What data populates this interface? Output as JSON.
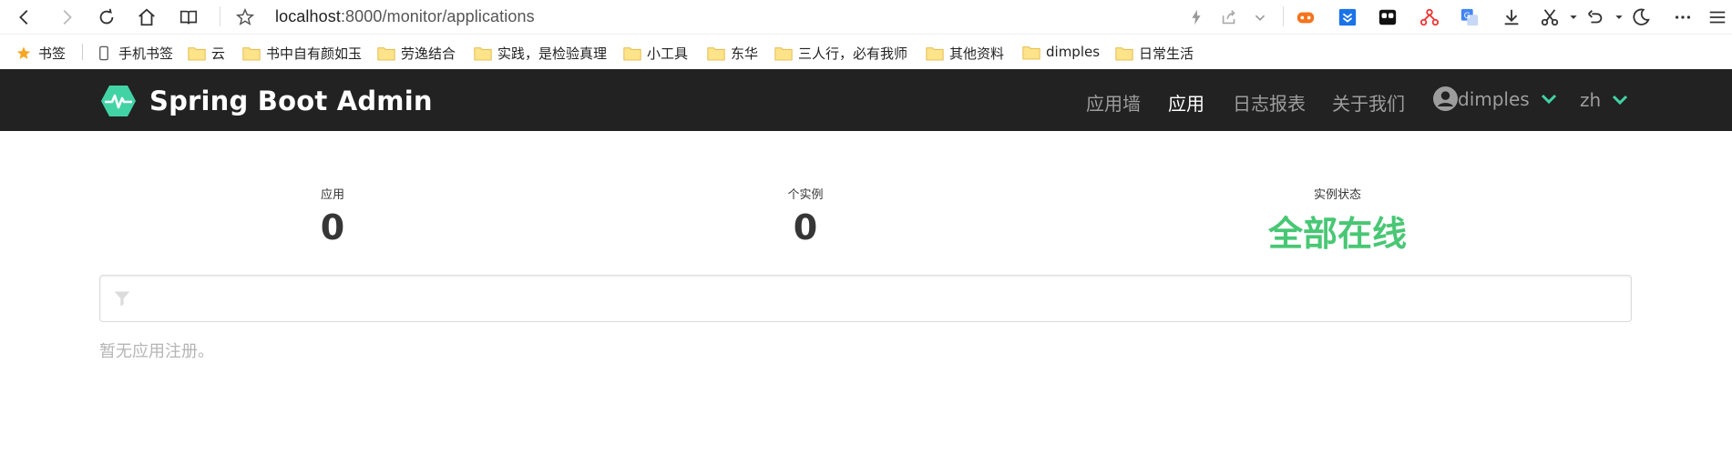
{
  "browser": {
    "url_host": "localhost",
    "url_path": ":8000/monitor/applications"
  },
  "bookmarks": [
    {
      "label": "书签",
      "icon": "star-icon"
    },
    {
      "label": "手机书签",
      "icon": "phone-icon"
    },
    {
      "label": "云",
      "icon": "folder-icon"
    },
    {
      "label": "书中自有颜如玉",
      "icon": "folder-icon"
    },
    {
      "label": "劳逸结合",
      "icon": "folder-icon"
    },
    {
      "label": "实践，是检验真理",
      "icon": "folder-icon"
    },
    {
      "label": "小工具",
      "icon": "folder-icon"
    },
    {
      "label": "东华",
      "icon": "folder-icon"
    },
    {
      "label": "三人行，必有我师",
      "icon": "folder-icon"
    },
    {
      "label": "其他资料",
      "icon": "folder-icon"
    },
    {
      "label": "dimples",
      "icon": "folder-icon"
    },
    {
      "label": "日常生活",
      "icon": "folder-icon"
    }
  ],
  "navbar": {
    "brand": "Spring Boot Admin",
    "items": [
      {
        "label": "应用墙",
        "active": false
      },
      {
        "label": "应用",
        "active": true
      },
      {
        "label": "日志报表",
        "active": false
      },
      {
        "label": "关于我们",
        "active": false
      }
    ],
    "user": "dimples",
    "language": "zh",
    "accent_color": "#42d3a5"
  },
  "stats": {
    "applications_label": "应用",
    "applications_value": "0",
    "instances_label": "个实例",
    "instances_value": "0",
    "status_label": "实例状态",
    "status_value": "全部在线",
    "status_color": "#48c774"
  },
  "filter": {
    "placeholder": ""
  },
  "empty_message": "暂无应用注册。"
}
